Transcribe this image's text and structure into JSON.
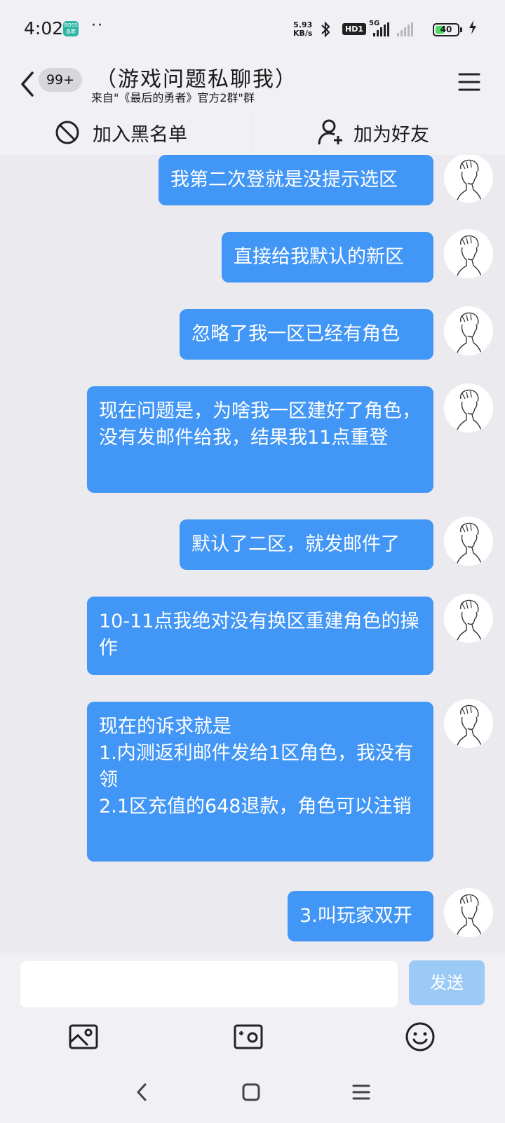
{
  "status_bar": {
    "time": "4:02",
    "app_badge": "BOSS 直聘",
    "dots": "··",
    "net_speed_value": "5.93",
    "net_speed_unit": "KB/s",
    "hd": "HD1",
    "network": "5G",
    "battery_level": "40",
    "battery_percent": 40
  },
  "header": {
    "unread_count": "99+",
    "title": "（游戏问题私聊我）",
    "subtitle": "来自\"《最后的勇者》官方2群\"群"
  },
  "actions": {
    "block_label": "加入黑名单",
    "add_friend_label": "加为好友"
  },
  "messages": [
    {
      "text": "我第二次登就是没提示选区"
    },
    {
      "text": "直接给我默认的新区"
    },
    {
      "text": "忽略了我一区已经有角色"
    },
    {
      "text": "现在问题是，为啥我一区建好了角色，没有发邮件给我，结果我11点重登"
    },
    {
      "text": "默认了二区，就发邮件了"
    },
    {
      "text": "10-11点我绝对没有换区重建角色的操作"
    },
    {
      "text": "现在的诉求就是\n1.内测返利邮件发给1区角色，我没有领\n2.1区充值的648退款，角色可以注销"
    },
    {
      "text": "3.叫玩家双开"
    }
  ],
  "composer": {
    "input_value": "",
    "send_label": "发送"
  },
  "icons": {
    "accent": "#4296f5",
    "send_disabled": "#9ccaf6"
  }
}
